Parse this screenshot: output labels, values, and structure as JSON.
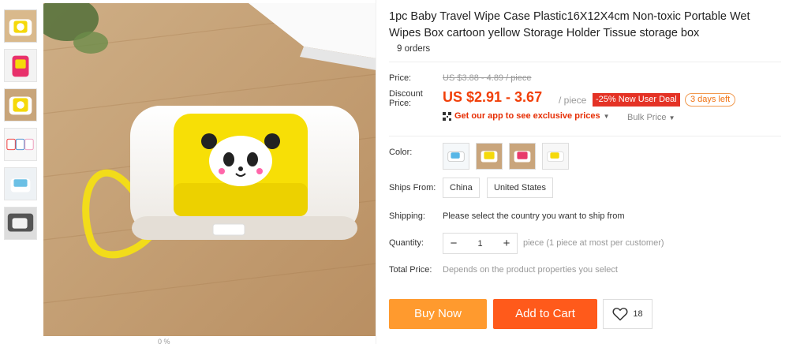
{
  "product": {
    "title": "1pc Baby Travel Wipe Case Plastic16X12X4cm Non-toxic Portable Wet Wipes Box cartoon yellow Storage Holder Tissue storage box",
    "orders": "9 orders"
  },
  "gallery": {
    "caption": "0 %",
    "thumbnails": [
      "yellow panda case",
      "pink case",
      "yellow case front",
      "cases set",
      "blue case",
      "case in use"
    ]
  },
  "price": {
    "label": "Price:",
    "original": "US $3.88 - 4.89 / piece",
    "discount_label": "Discount Price:",
    "discount": "US $2.91 - 3.67",
    "unit": "/ piece",
    "promo_tag": "-25% New User Deal",
    "days_left": "3 days left",
    "app_link": "Get our app to see exclusive prices",
    "bulk": "Bulk Price"
  },
  "color": {
    "label": "Color:",
    "options": [
      "blue",
      "pink",
      "red",
      "yellow"
    ]
  },
  "ships_from": {
    "label": "Ships From:",
    "options": [
      "China",
      "United States"
    ]
  },
  "shipping": {
    "label": "Shipping:",
    "text": "Please select the country you want to ship from"
  },
  "quantity": {
    "label": "Quantity:",
    "value": "1",
    "minus": "−",
    "plus": "+",
    "note": "piece (1 piece at most per customer)"
  },
  "total": {
    "label": "Total Price:",
    "note": "Depends on the product properties you select"
  },
  "actions": {
    "buy_now": "Buy Now",
    "add_to_cart": "Add to Cart",
    "wishlist_count": "18"
  },
  "colors": {
    "accent_orange": "#ff9a2e",
    "cart_orange": "#ff5a1b",
    "price_red": "#f1400a",
    "promo_red": "#e43225"
  }
}
